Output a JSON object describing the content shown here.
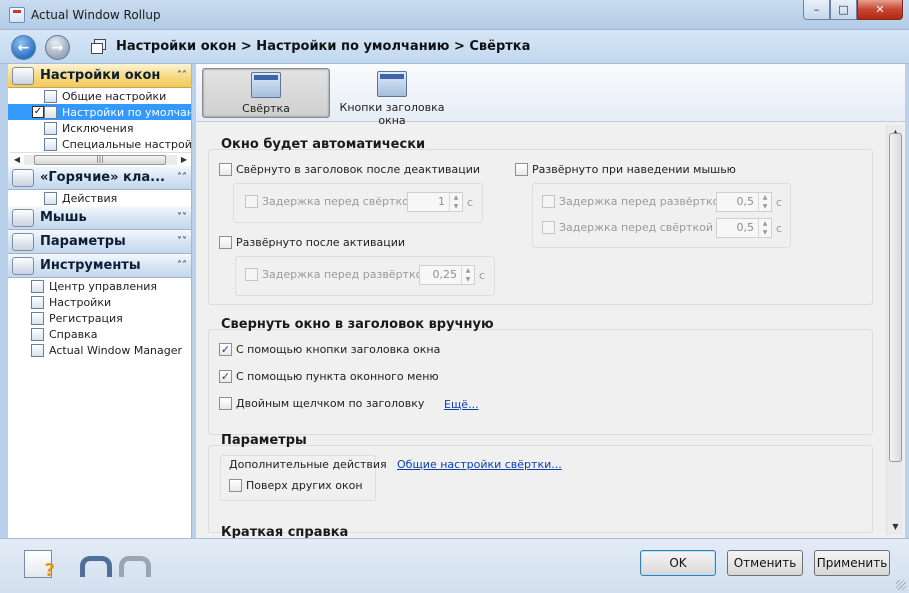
{
  "window": {
    "title": "Actual Window Rollup",
    "min": "–",
    "max": "□",
    "close": "✕"
  },
  "nav": {
    "back": "←",
    "forward": "→",
    "breadcrumb": "Настройки окон > Настройки по умолчанию > Свёртка"
  },
  "sidebar": {
    "sections": [
      {
        "label": "Настройки окон",
        "chevron": "˄˄"
      },
      {
        "label": "«Горячие» кла...",
        "chevron": "˄˄"
      },
      {
        "label": "Мышь",
        "chevron": "˅˅"
      },
      {
        "label": "Параметры",
        "chevron": "˅˅"
      },
      {
        "label": "Инструменты",
        "chevron": "˄˄"
      }
    ],
    "window_items": [
      "Общие настройки",
      "Настройки по умолчанию",
      "Исключения",
      "Специальные настройки"
    ],
    "checkbox_mark": "✓",
    "scroll_left": "◀",
    "scroll_right": "▶",
    "scroll_grip": "|||",
    "hotkey_items": [
      "Действия"
    ],
    "tool_items": [
      "Центр управления",
      "Настройки",
      "Регистрация",
      "Справка",
      "Actual Window Manager"
    ]
  },
  "tabs": [
    {
      "label": "Свёртка"
    },
    {
      "label": "Кнопки заголовка окна"
    }
  ],
  "auto": {
    "title": "Окно будет автоматически",
    "rollup_deactivate": "Свёрнуто в заголовок после деактивации",
    "delay_before_rollup": "Задержка перед свёрткой",
    "delay_before_rollup_value": "1",
    "unroll_activate": "Развёрнуто после активации",
    "delay_before_unroll": "Задержка перед развёрткой",
    "delay_before_unroll_value": "0,25",
    "unroll_hover": "Развёрнуто при наведении мышью",
    "hover_delay_unroll": "Задержка перед развёрткой",
    "hover_delay_unroll_value": "0,5",
    "hover_delay_rollup": "Задержка перед свёрткой",
    "hover_delay_rollup_value": "0,5",
    "unit": "с",
    "spin_up": "▲",
    "spin_down": "▼"
  },
  "manual": {
    "title": "Свернуть окно в заголовок вручную",
    "title_button": "С помощью кнопки заголовка окна",
    "window_menu": "С помощью пункта оконного меню",
    "double_click": "Двойным щелчком по заголовку",
    "more_link": "Ещё...",
    "check_mark": "✓"
  },
  "params": {
    "title": "Параметры",
    "extra_actions": "Дополнительные действия",
    "on_top": "Поверх других окон",
    "general_link": "Общие настройки свёртки..."
  },
  "help": {
    "title": "Краткая справка"
  },
  "vscroll": {
    "up": "▲",
    "down": "▼"
  },
  "buttons": {
    "ok": "OK",
    "cancel": "Отменить",
    "apply": "Применить"
  }
}
